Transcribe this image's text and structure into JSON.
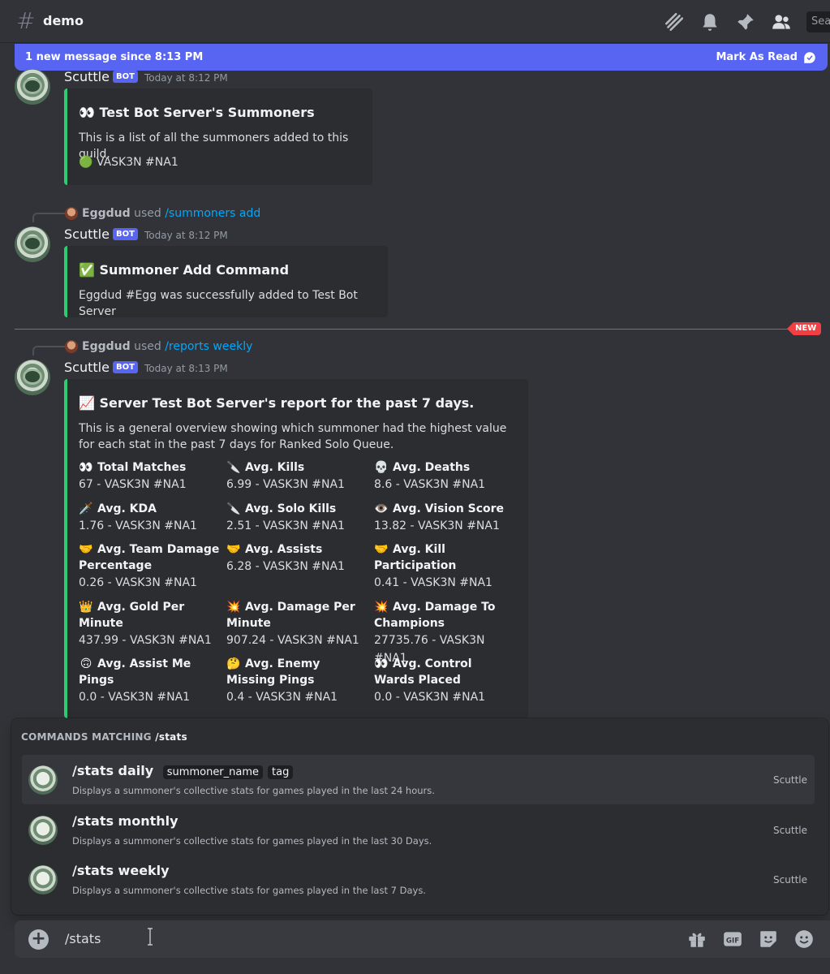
{
  "header": {
    "channel": "demo",
    "search_placeholder": "Search"
  },
  "new_messages_bar": {
    "text": "1 new message since 8:13 PM",
    "mark_as_read": "Mark As Read"
  },
  "messages": [
    {
      "author": "Scuttle",
      "badge": "BOT",
      "time": "Today at 8:12 PM",
      "embed": {
        "title": "👀 Test Bot Server's Summoners",
        "description": "This is a list of all the summoners added to this guild.",
        "line": "🟢 VASK3N #NA1"
      }
    },
    {
      "reply": {
        "user": "Eggdud",
        "used": "used",
        "command": "/summoners add"
      },
      "author": "Scuttle",
      "badge": "BOT",
      "time": "Today at 8:12 PM",
      "embed": {
        "title": "✅ Summoner Add Command",
        "description": "Eggdud #Egg was successfully added to Test Bot Server"
      }
    },
    {
      "reply": {
        "user": "Eggdud",
        "used": "used",
        "command": "/reports weekly"
      },
      "author": "Scuttle",
      "badge": "BOT",
      "time": "Today at 8:13 PM",
      "embed": {
        "title": "📈 Server Test Bot Server's report for the past 7 days.",
        "description": "This is a general overview showing which summoner had the highest value for each stat in the past 7 days for Ranked Solo Queue.",
        "fields": [
          {
            "emoji": "👀",
            "name": "Total Matches",
            "value": "67 - VASK3N #NA1"
          },
          {
            "emoji": "🔪",
            "name": "Avg. Kills",
            "value": "6.99 - VASK3N #NA1"
          },
          {
            "emoji": "💀",
            "name": "Avg. Deaths",
            "value": "8.6 - VASK3N #NA1"
          },
          {
            "emoji": "🗡️",
            "name": "Avg. KDA",
            "value": "1.76 - VASK3N #NA1"
          },
          {
            "emoji": "🔪",
            "name": "Avg. Solo Kills",
            "value": "2.51 - VASK3N #NA1"
          },
          {
            "emoji": "👁️",
            "name": "Avg. Vision Score",
            "value": "13.82 - VASK3N #NA1"
          },
          {
            "emoji": "🤝",
            "name": "Avg. Team Damage Percentage",
            "value": "0.26 - VASK3N #NA1"
          },
          {
            "emoji": "🤝",
            "name": "Avg. Assists",
            "value": "6.28 - VASK3N #NA1"
          },
          {
            "emoji": "🤝",
            "name": "Avg. Kill Participation",
            "value": "0.41 - VASK3N #NA1"
          },
          {
            "emoji": "👑",
            "name": "Avg. Gold Per Minute",
            "value": "437.99 - VASK3N #NA1"
          },
          {
            "emoji": "💥",
            "name": "Avg. Damage Per Minute",
            "value": "907.24 - VASK3N #NA1"
          },
          {
            "emoji": "💥",
            "name": "Avg. Damage To Champions",
            "value": "27735.76 - VASK3N #NA1"
          },
          {
            "emoji": "🙃",
            "name": "Avg. Assist Me Pings",
            "value": "0.0 - VASK3N #NA1"
          },
          {
            "emoji": "🤔",
            "name": "Avg. Enemy Missing Pings",
            "value": "0.4 - VASK3N #NA1"
          },
          {
            "emoji": "👀",
            "name": "Avg. Control Wards Placed",
            "value": "0.0 - VASK3N #NA1"
          }
        ]
      }
    }
  ],
  "new_divider": "NEW",
  "autocomplete": {
    "heading_prefix": "COMMANDS MATCHING",
    "heading_query": "/stats",
    "commands": [
      {
        "name": "/stats daily",
        "options": [
          "summoner_name",
          "tag"
        ],
        "description": "Displays a summoner's collective stats for games played in the last 24 hours.",
        "source": "Scuttle"
      },
      {
        "name": "/stats monthly",
        "options": [],
        "description": "Displays a summoner's collective stats for games played in the last 30 Days.",
        "source": "Scuttle"
      },
      {
        "name": "/stats weekly",
        "options": [],
        "description": "Displays a summoner's collective stats for games played in the last 7 Days.",
        "source": "Scuttle"
      }
    ]
  },
  "composer": {
    "value": "/stats"
  },
  "colors": {
    "blurple": "#5865f2",
    "embed_accent": "#2ecc71",
    "new_red": "#f23f43",
    "link": "#00a8fc"
  }
}
